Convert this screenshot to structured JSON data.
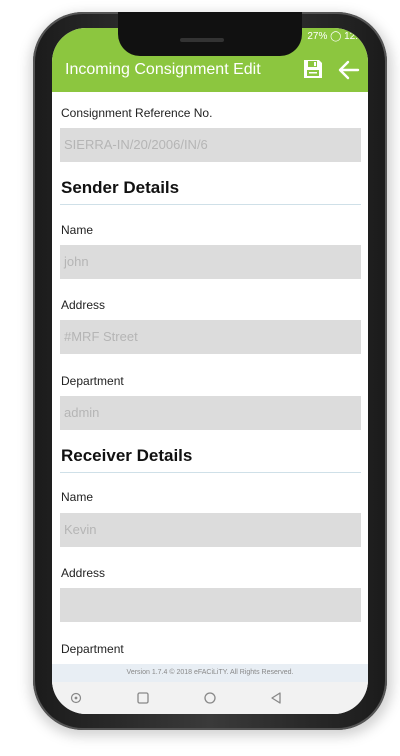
{
  "status": {
    "text": "27% ◯ 12:"
  },
  "appbar": {
    "title": "Incoming Consignment Edit"
  },
  "consignment": {
    "label": "Consignment Reference No.",
    "value": "SIERRA-IN/20/2006/IN/6"
  },
  "sender": {
    "title": "Sender Details",
    "name_label": "Name",
    "name_value": "john",
    "address_label": "Address",
    "address_value": "#MRF Street",
    "department_label": "Department",
    "department_value": "admin"
  },
  "receiver": {
    "title": "Receiver Details",
    "name_label": "Name",
    "name_value": "Kevin",
    "address_label": "Address",
    "address_value": "",
    "department_label": "Department"
  },
  "footer": {
    "text": "Version 1.7.4 © 2018 eFACiLiTY. All Rights Reserved."
  },
  "colors": {
    "accent": "#8cc63f",
    "field": "#dcdcdc"
  },
  "icons": {
    "save": "save-icon",
    "back": "arrow-left-icon"
  }
}
